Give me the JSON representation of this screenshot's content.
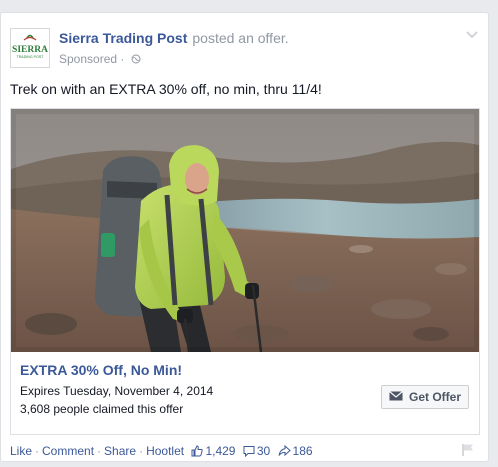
{
  "post": {
    "page_name": "Sierra Trading Post",
    "action": "posted an offer.",
    "sponsored": "Sponsored",
    "sponsored_sep": "·",
    "text": "Trek on with an EXTRA 30% off, no min, thru 11/4!"
  },
  "logo": {
    "main": "SIERRA",
    "sub": "TRADING POST",
    "colors": {
      "green": "#2e7d3a",
      "red": "#c0392b"
    }
  },
  "offer": {
    "title": "EXTRA 30% Off, No Min!",
    "expires": "Expires Tuesday, November 4, 2014",
    "claimed": "3,608 people claimed this offer",
    "button_label": "Get Offer"
  },
  "actions": {
    "like": "Like",
    "comment": "Comment",
    "share": "Share",
    "hootlet": "Hootlet",
    "separator": "·",
    "likes_count": "1,429",
    "comments_count": "30",
    "shares_count": "186"
  },
  "icons": {
    "chevron": "chevron-down-icon",
    "globe": "globe-icon",
    "envelope": "envelope-icon",
    "thumb": "thumbs-up-icon",
    "comment": "comment-icon",
    "share": "share-arrow-icon",
    "flag": "flag-icon"
  },
  "colors": {
    "link": "#3b5998",
    "muted": "#9197a3",
    "text": "#141823",
    "background": "#e9eaed"
  }
}
